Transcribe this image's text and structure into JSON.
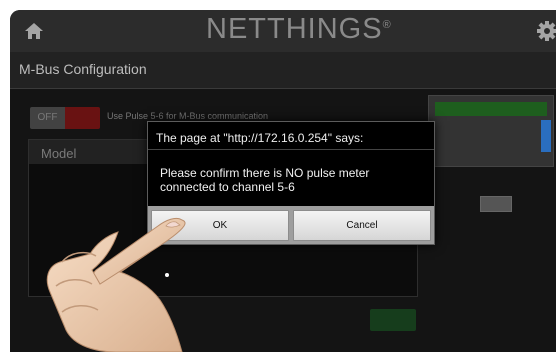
{
  "app": {
    "logo_text": "NETTHINGS",
    "logo_mark": "®",
    "home_icon": "home-icon",
    "settings_icon": "gear-icon"
  },
  "page": {
    "title": "M-Bus Configuration"
  },
  "toggle": {
    "off_label": "OFF",
    "description": "Use Pulse 5-6 for M-Bus communication",
    "state": "on"
  },
  "model_panel": {
    "header": "Model"
  },
  "dialog": {
    "title": "The page at \"http://172.16.0.254\" says:",
    "line1": "Please confirm there is NO pulse meter",
    "line2": "connected to channel 5-6",
    "ok_label": "OK",
    "cancel_label": "Cancel"
  },
  "colors": {
    "background": "#1a1a1a",
    "toggle_on": "#d01010",
    "dialog_bg": "#000000"
  }
}
